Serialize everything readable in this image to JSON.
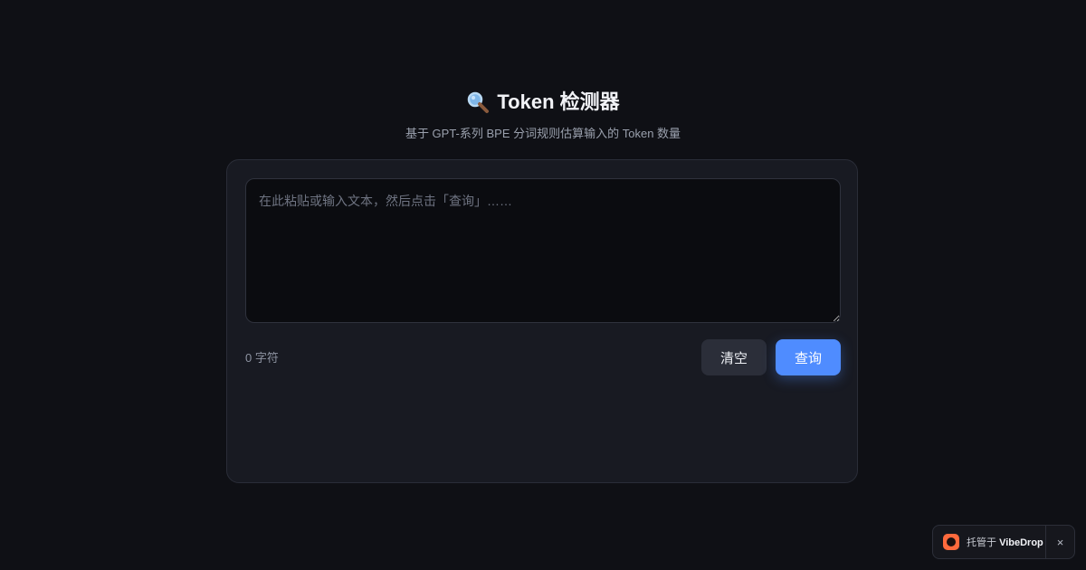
{
  "header": {
    "title": "Token 检测器",
    "subtitle": "基于 GPT-系列 BPE 分词规则估算输入的 Token 数量",
    "title_icon": "magnifier-icon"
  },
  "input": {
    "value": "",
    "placeholder": "在此粘贴或输入文本，然后点击「查询」……"
  },
  "footer": {
    "char_count": "0 字符",
    "clear_label": "清空",
    "query_label": "查询"
  },
  "badge": {
    "prefix": "托管于",
    "brand": "VibeDrop",
    "close": "×",
    "logo_icon": "vibedrop-logo-icon"
  },
  "colors": {
    "background": "#0f1015",
    "card": "#181a22",
    "accent": "#4f8cff",
    "badge_logo": "#ff6a3d"
  }
}
